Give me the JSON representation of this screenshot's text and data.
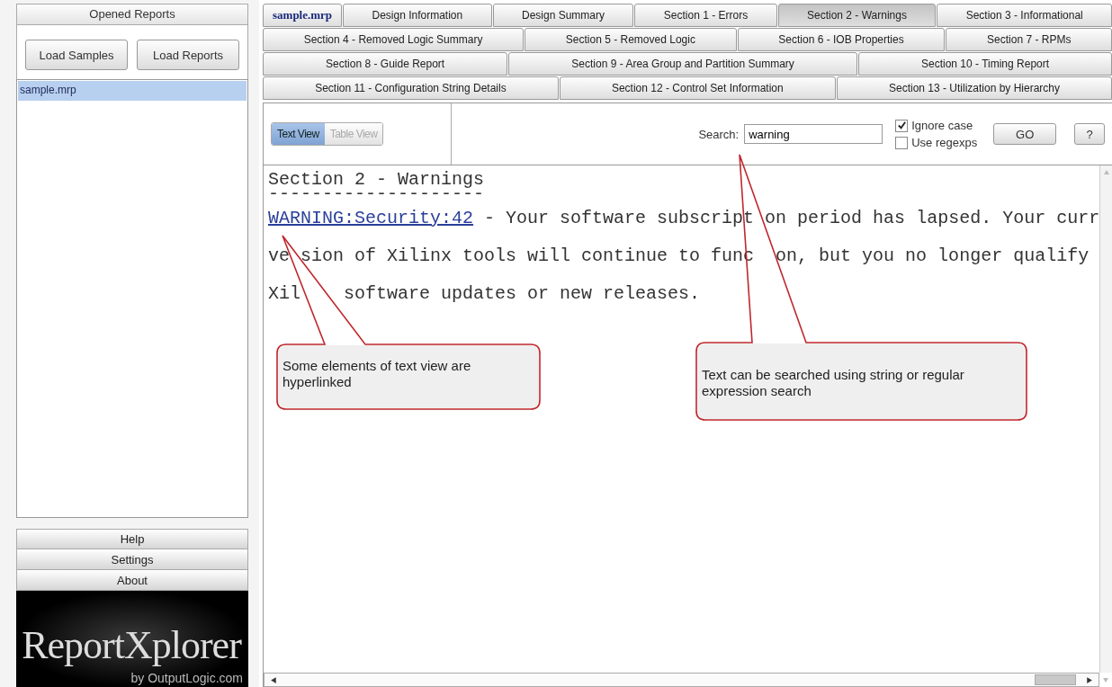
{
  "sidebar": {
    "title": "Opened Reports",
    "buttons": [
      "Load Samples",
      "Load Reports"
    ],
    "files": [
      {
        "label": "sample.mrp",
        "selected": true
      }
    ],
    "sections": [
      "Help",
      "Settings",
      "About"
    ],
    "logo": {
      "name": "ReportXplorer",
      "byline": "by OutputLogic.com"
    }
  },
  "tab_rows": [
    [
      {
        "label": "sample.mrp",
        "kind": "file",
        "selected": false
      },
      {
        "label": "Design Information",
        "kind": "section",
        "selected": false
      },
      {
        "label": "Design Summary",
        "kind": "section",
        "selected": false
      },
      {
        "label": "Section 1 - Errors",
        "kind": "section",
        "selected": false
      },
      {
        "label": "Section 2 - Warnings",
        "kind": "section",
        "selected": true
      },
      {
        "label": "Section 3 - Informational",
        "kind": "section",
        "selected": false
      }
    ],
    [
      {
        "label": "Section 4 - Removed Logic Summary",
        "kind": "section",
        "selected": false
      },
      {
        "label": "Section 5 - Removed Logic",
        "kind": "section",
        "selected": false
      },
      {
        "label": "Section 6 - IOB Properties",
        "kind": "section",
        "selected": false
      },
      {
        "label": "Section 7 - RPMs",
        "kind": "section",
        "selected": false
      }
    ],
    [
      {
        "label": "Section 8 - Guide Report",
        "kind": "section",
        "selected": false
      },
      {
        "label": "Section 9 - Area Group and Partition Summary",
        "kind": "section",
        "selected": false
      },
      {
        "label": "Section 10 - Timing Report",
        "kind": "section",
        "selected": false
      }
    ],
    [
      {
        "label": "Section 11 - Configuration String Details",
        "kind": "section",
        "selected": false
      },
      {
        "label": "Section 12 - Control Set Information",
        "kind": "section",
        "selected": false
      },
      {
        "label": "Section 13 - Utilization by Hierarchy",
        "kind": "section",
        "selected": false
      }
    ]
  ],
  "toolbar": {
    "views": [
      {
        "label": "Text View",
        "selected": true,
        "disabled": false
      },
      {
        "label": "Table View",
        "selected": false,
        "disabled": true
      }
    ],
    "search": {
      "label": "Search:",
      "value": "warning"
    },
    "options": [
      {
        "label": "Ignore case",
        "checked": true
      },
      {
        "label": "Use regexps",
        "checked": false
      }
    ],
    "buttons": [
      "GO",
      "?"
    ]
  },
  "report": {
    "heading": "Section 2 - Warnings",
    "rule": "--------------------",
    "lines": [
      {
        "link": "WARNING:Security:42",
        "text": " - Your software subscript on period has lapsed. Your curr"
      },
      {
        "text": "ve sion of Xilinx tools will continue to func  on, but you no longer qualify"
      },
      {
        "text": "Xil    software updates or new releases."
      }
    ]
  },
  "callouts": [
    {
      "text": "Some elements of text view are hyperlinked"
    },
    {
      "text": "Text can be searched using string or regular expression search"
    }
  ]
}
